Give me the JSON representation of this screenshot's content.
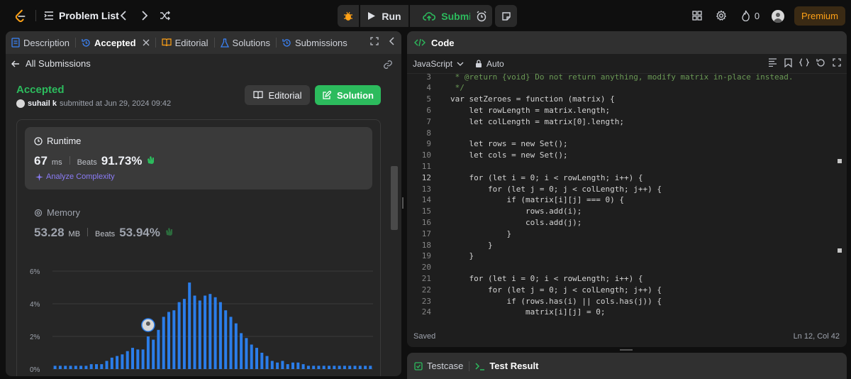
{
  "topbar": {
    "problem_list": "Problem List",
    "run": "Run",
    "submit": "Submit",
    "fire_count": "0",
    "premium": "Premium",
    "icons": [
      "prev-icon",
      "next-icon",
      "shuffle-icon",
      "debug-icon",
      "timer-icon",
      "notes-icon",
      "layout-icon",
      "settings-icon",
      "fire-icon"
    ]
  },
  "left": {
    "tabs": [
      {
        "label": "Description"
      },
      {
        "label": "Accepted"
      },
      {
        "label": "Editorial"
      },
      {
        "label": "Solutions"
      },
      {
        "label": "Submissions"
      }
    ],
    "all_submissions": "All Submissions",
    "status": "Accepted",
    "user": "suhail k",
    "submitted_text": "submitted at Jun 29, 2024 09:42",
    "editorial_btn": "Editorial",
    "solution_btn": "Solution",
    "runtime": {
      "title": "Runtime",
      "value": "67",
      "unit": "ms",
      "beats_label": "Beats",
      "beats": "91.73%",
      "analyze": "Analyze Complexity"
    },
    "memory": {
      "title": "Memory",
      "value": "53.28",
      "unit": "MB",
      "beats_label": "Beats",
      "beats": "53.94%"
    }
  },
  "chart_data": {
    "type": "bar",
    "yticks": [
      "6%",
      "4%",
      "2%",
      "0%"
    ],
    "ylim": [
      0,
      6
    ],
    "values": [
      0.2,
      0.2,
      0.2,
      0.2,
      0.2,
      0.2,
      0.2,
      0.3,
      0.3,
      0.3,
      0.5,
      0.7,
      0.8,
      0.9,
      1.1,
      1.3,
      1.2,
      1.2,
      2.0,
      1.8,
      2.4,
      3.2,
      3.5,
      3.6,
      4.1,
      4.3,
      5.3,
      4.5,
      4.2,
      4.5,
      4.6,
      4.4,
      4.1,
      3.6,
      3.2,
      2.8,
      2.2,
      1.9,
      1.5,
      1.3,
      1.0,
      0.8,
      0.5,
      0.4,
      0.5,
      0.3,
      0.4,
      0.4,
      0.3,
      0.2,
      0.2,
      0.2,
      0.2,
      0.2,
      0.2,
      0.2,
      0.2,
      0.2,
      0.2,
      0.2,
      0.2,
      0.2
    ],
    "highlight_index": 18,
    "bar_color": "#2b7de9"
  },
  "code": {
    "title": "Code",
    "language": "JavaScript",
    "auto": "Auto",
    "saved": "Saved",
    "cursor": "Ln 12, Col 42",
    "current_line": 12,
    "lines": [
      {
        "n": "3",
        "t": " * @return {void} Do not return anything, modify matrix in-place instead."
      },
      {
        "n": "4",
        "t": " */"
      },
      {
        "n": "5",
        "t": "var setZeroes = function (matrix) {"
      },
      {
        "n": "6",
        "t": "    let rowLength = matrix.length;"
      },
      {
        "n": "7",
        "t": "    let colLength = matrix[0].length;"
      },
      {
        "n": "8",
        "t": ""
      },
      {
        "n": "9",
        "t": "    let rows = new Set();"
      },
      {
        "n": "10",
        "t": "    let cols = new Set();"
      },
      {
        "n": "11",
        "t": ""
      },
      {
        "n": "12",
        "t": "    for (let i = 0; i < rowLength; i++) {"
      },
      {
        "n": "13",
        "t": "        for (let j = 0; j < colLength; j++) {"
      },
      {
        "n": "14",
        "t": "            if (matrix[i][j] === 0) {"
      },
      {
        "n": "15",
        "t": "                rows.add(i);"
      },
      {
        "n": "16",
        "t": "                cols.add(j);"
      },
      {
        "n": "17",
        "t": "            }"
      },
      {
        "n": "18",
        "t": "        }"
      },
      {
        "n": "19",
        "t": "    }"
      },
      {
        "n": "20",
        "t": ""
      },
      {
        "n": "21",
        "t": "    for (let i = 0; i < rowLength; i++) {"
      },
      {
        "n": "22",
        "t": "        for (let j = 0; j < colLength; j++) {"
      },
      {
        "n": "23",
        "t": "            if (rows.has(i) || cols.has(j)) {"
      },
      {
        "n": "24",
        "t": "                matrix[i][j] = 0;"
      }
    ]
  },
  "testpanel": {
    "testcase": "Testcase",
    "result": "Test Result"
  }
}
